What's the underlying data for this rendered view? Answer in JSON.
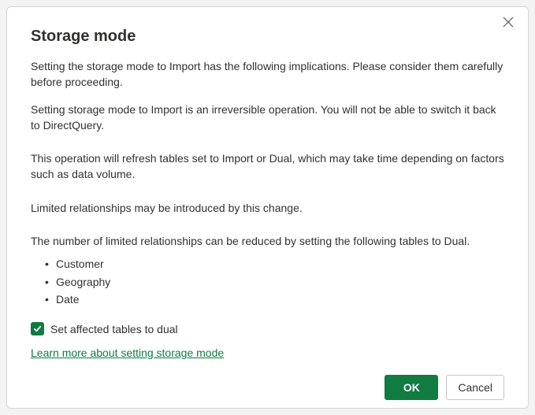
{
  "dialog": {
    "title": "Storage mode",
    "paragraphs": {
      "intro": "Setting the storage mode to Import has the following implications. Please consider them carefully before proceeding.",
      "irreversible": "Setting storage mode to Import is an irreversible operation.  You will not be able to switch it back to DirectQuery.",
      "refresh": "This operation will refresh tables set to Import or Dual, which may take time depending on factors such as data volume.",
      "limited": "Limited relationships may be introduced by this change.",
      "reduce": "The number of limited relationships can be reduced by setting the following tables to Dual."
    },
    "tables": [
      "Customer",
      "Geography",
      "Date"
    ],
    "checkbox": {
      "label": "Set affected tables to dual",
      "checked": true
    },
    "link": "Learn more about setting storage mode",
    "buttons": {
      "ok": "OK",
      "cancel": "Cancel"
    }
  },
  "colors": {
    "accent": "#107c41"
  }
}
